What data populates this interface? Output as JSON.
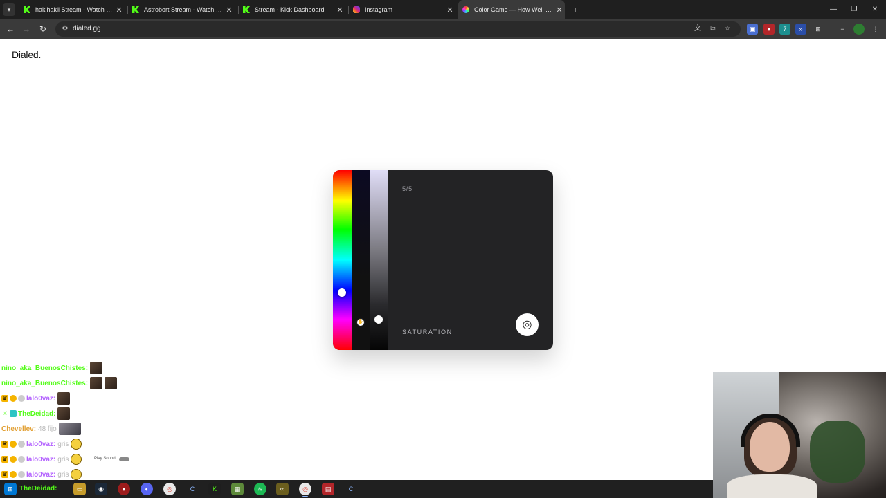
{
  "browser": {
    "tabs": [
      {
        "label": "hakihakii Stream - Watch Live o",
        "icon": "kick-icon"
      },
      {
        "label": "Astrobort Stream - Watch Live o",
        "icon": "kick-icon"
      },
      {
        "label": "Stream - Kick Dashboard",
        "icon": "kick-icon"
      },
      {
        "label": "Instagram",
        "icon": "instagram-icon"
      },
      {
        "label": "Color Game — How Well Can Y",
        "icon": "color-wheel-icon",
        "active": true
      }
    ],
    "url": "dialed.gg",
    "accent": "#53fc18"
  },
  "page": {
    "brand": "Dialed.",
    "game": {
      "progress": "5/5",
      "parameter": "SATURATION",
      "hue_handle_level": 0.68,
      "lightness_handle_level": 0.83,
      "colors": {
        "card_bg": "#232325",
        "handle": "#ffffff"
      }
    }
  },
  "chat": [
    {
      "user": "nino_aka_BuenosChistes:",
      "message": "",
      "color": "#53fc18"
    },
    {
      "user": "nino_aka_BuenosChistes:",
      "message": "",
      "color": "#53fc18"
    },
    {
      "user": "lalo0vaz:",
      "message": "",
      "color": "#b565ff"
    },
    {
      "user": "TheDeidad:",
      "message": "",
      "color": "#53fc18"
    },
    {
      "user": "Chevellev:",
      "message": "48 fijo",
      "color": "#e2a034"
    },
    {
      "user": "lalo0vaz:",
      "message": "gris",
      "color": "#b565ff"
    },
    {
      "user": "lalo0vaz:",
      "message": "gris",
      "color": "#b565ff"
    },
    {
      "user": "lalo0vaz:",
      "message": "gris",
      "color": "#b565ff"
    }
  ],
  "chat_overlay": {
    "play_sound": "Play Sound"
  },
  "taskbar": {
    "user_label": "TheDeidad:"
  }
}
